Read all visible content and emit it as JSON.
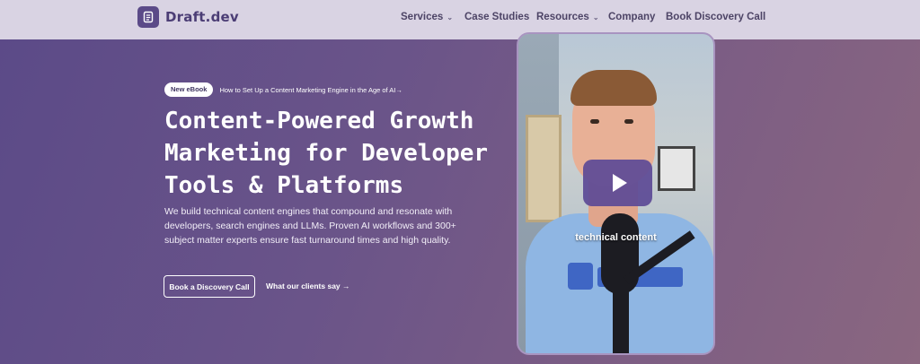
{
  "brand": {
    "name": "Draft.dev",
    "logo_icon": "document-icon"
  },
  "nav": {
    "items": [
      {
        "label": "Services",
        "has_dropdown": true
      },
      {
        "label": "Case Studies",
        "has_dropdown": false
      },
      {
        "label": "Resources",
        "has_dropdown": true
      },
      {
        "label": "Company",
        "has_dropdown": false
      },
      {
        "label": "Book Discovery Call",
        "has_dropdown": false
      }
    ],
    "chevron": "⌄"
  },
  "hero": {
    "badge": "New eBook",
    "badge_link": "How to Set Up a Content Marketing Engine in the Age of AI→",
    "headline": "Content-Powered Growth Marketing for Developer Tools & Platforms",
    "subtext": "We build technical content engines that compound and resonate with developers, search engines and LLMs. Proven AI workflows and 300+ subject matter experts ensure fast turnaround times and high quality.",
    "cta_primary": "Book a Discovery Call",
    "cta_secondary": "What our clients say →"
  },
  "video": {
    "caption": "technical content",
    "play_icon": "play-icon"
  },
  "colors": {
    "accent": "#5b4a88",
    "nav_bg": "#d9d3e3",
    "nav_text": "#4d4466",
    "play_button": "#5c4a96"
  }
}
